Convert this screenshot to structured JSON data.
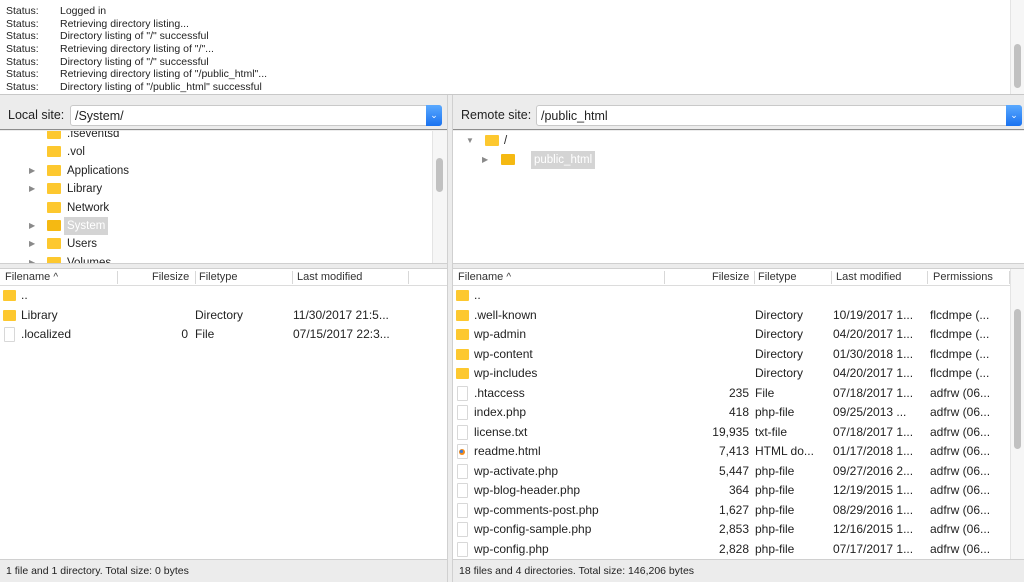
{
  "message_log": [
    {
      "type": "Status:",
      "text": "Logged in"
    },
    {
      "type": "Status:",
      "text": "Retrieving directory listing..."
    },
    {
      "type": "Status:",
      "text": "Directory listing of \"/\" successful"
    },
    {
      "type": "Status:",
      "text": "Retrieving directory listing of \"/\"..."
    },
    {
      "type": "Status:",
      "text": "Directory listing of \"/\" successful"
    },
    {
      "type": "Status:",
      "text": "Retrieving directory listing of \"/public_html\"..."
    },
    {
      "type": "Status:",
      "text": "Directory listing of \"/public_html\" successful"
    }
  ],
  "local": {
    "site_label": "Local site:",
    "path": "/System/",
    "tree": [
      {
        "name": ".fseventsd",
        "expander": false,
        "clipped": true
      },
      {
        "name": ".vol",
        "expander": false
      },
      {
        "name": "Applications",
        "expander": true
      },
      {
        "name": "Library",
        "expander": true
      },
      {
        "name": "Network",
        "expander": false
      },
      {
        "name": "System",
        "expander": true,
        "selected": true
      },
      {
        "name": "Users",
        "expander": true
      },
      {
        "name": "Volumes",
        "expander": true
      }
    ],
    "columns": {
      "filename": "Filename",
      "sort_indicator": "^",
      "filesize": "Filesize",
      "filetype": "Filetype",
      "last_modified": "Last modified"
    },
    "files": [
      {
        "icon": "folder",
        "name": "..",
        "size": "",
        "type": "",
        "modified": ""
      },
      {
        "icon": "folder",
        "name": "Library",
        "size": "",
        "type": "Directory",
        "modified": "11/30/2017 21:5..."
      },
      {
        "icon": "file",
        "name": ".localized",
        "size": "0",
        "type": "File",
        "modified": "07/15/2017 22:3..."
      }
    ],
    "status": "1 file and 1 directory. Total size: 0 bytes"
  },
  "remote": {
    "site_label": "Remote site:",
    "path": "/public_html",
    "tree": [
      {
        "name": "/",
        "expander": "open",
        "level": 0
      },
      {
        "name": "public_html",
        "expander": "closed",
        "level": 1,
        "selected": true
      }
    ],
    "columns": {
      "filename": "Filename",
      "sort_indicator": "^",
      "filesize": "Filesize",
      "filetype": "Filetype",
      "last_modified": "Last modified",
      "permissions": "Permissions"
    },
    "files": [
      {
        "icon": "folder",
        "name": "..",
        "size": "",
        "type": "",
        "modified": "",
        "perms": ""
      },
      {
        "icon": "folder",
        "name": ".well-known",
        "size": "",
        "type": "Directory",
        "modified": "10/19/2017 1...",
        "perms": "flcdmpe (..."
      },
      {
        "icon": "folder",
        "name": "wp-admin",
        "size": "",
        "type": "Directory",
        "modified": "04/20/2017 1...",
        "perms": "flcdmpe (..."
      },
      {
        "icon": "folder",
        "name": "wp-content",
        "size": "",
        "type": "Directory",
        "modified": "01/30/2018 1...",
        "perms": "flcdmpe (..."
      },
      {
        "icon": "folder",
        "name": "wp-includes",
        "size": "",
        "type": "Directory",
        "modified": "04/20/2017 1...",
        "perms": "flcdmpe (..."
      },
      {
        "icon": "file",
        "name": ".htaccess",
        "size": "235",
        "type": "File",
        "modified": "07/18/2017 1...",
        "perms": "adfrw (06..."
      },
      {
        "icon": "file",
        "name": "index.php",
        "size": "418",
        "type": "php-file",
        "modified": "09/25/2013 ...",
        "perms": "adfrw (06..."
      },
      {
        "icon": "file",
        "name": "license.txt",
        "size": "19,935",
        "type": "txt-file",
        "modified": "07/18/2017 1...",
        "perms": "adfrw (06..."
      },
      {
        "icon": "html",
        "name": "readme.html",
        "size": "7,413",
        "type": "HTML do...",
        "modified": "01/17/2018 1...",
        "perms": "adfrw (06..."
      },
      {
        "icon": "file",
        "name": "wp-activate.php",
        "size": "5,447",
        "type": "php-file",
        "modified": "09/27/2016 2...",
        "perms": "adfrw (06..."
      },
      {
        "icon": "file",
        "name": "wp-blog-header.php",
        "size": "364",
        "type": "php-file",
        "modified": "12/19/2015 1...",
        "perms": "adfrw (06..."
      },
      {
        "icon": "file",
        "name": "wp-comments-post.php",
        "size": "1,627",
        "type": "php-file",
        "modified": "08/29/2016 1...",
        "perms": "adfrw (06..."
      },
      {
        "icon": "file",
        "name": "wp-config-sample.php",
        "size": "2,853",
        "type": "php-file",
        "modified": "12/16/2015 1...",
        "perms": "adfrw (06..."
      },
      {
        "icon": "file",
        "name": "wp-config.php",
        "size": "2,828",
        "type": "php-file",
        "modified": "07/17/2017 1...",
        "perms": "adfrw (06..."
      }
    ],
    "status": "18 files and 4 directories. Total size: 146,206 bytes"
  }
}
